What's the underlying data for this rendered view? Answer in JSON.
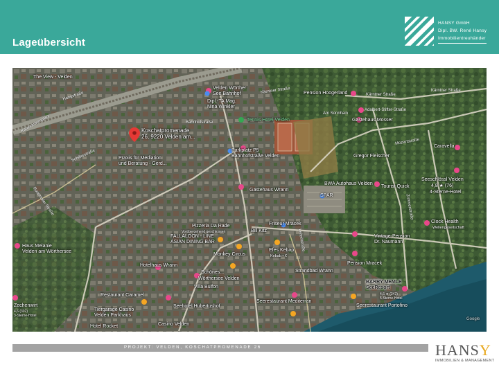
{
  "header": {
    "title": "Lageübersicht",
    "company_line1": "HANSY GmbH",
    "company_line2": "Dipl. BW. René Hansy",
    "company_line3": "Immobilientreuhänder"
  },
  "map": {
    "labels": {
      "main_marker": "Koschatpromenade\n26, 9220 Velden am...",
      "velden_bahnhof": "Velden Wörther\nSee Bahnhof",
      "dipl_ta_mag": "Dipl.-TA Mag.\nNina Winkler",
      "tennis": "Tennis Hotel Velden",
      "pension_hoogerland": "Pension Hoogerland",
      "gaestehaus_mosser": "Gästehaus Mosser",
      "caravella": "Caravella",
      "gregor_fleischer": "Gregor Fleischer",
      "parkplatz": "Parkplatz P5\nBahnhofstraße Velden",
      "mediation": "Praxis für Mediation\nund Beratung - Gerd...",
      "gaestehaus_wrann": "Gästehaus Wrann",
      "bwa_autohaus": "BWA Autohaus Velden",
      "spar": "SPAR",
      "tourist_quick": "Tourist Quick",
      "seeschloessl": "Seeschlössl Velden",
      "seeschloessl_rating": "4,8 ★ (76)",
      "seeschloessl_type": "4-Sterne-Hotel",
      "pizzeria": "Pizzeria Da Rade",
      "pizzeria_sub": "Vorübergehend geschlossen",
      "friseur": "Friseur Mracek",
      "fallalo": "FALLALOON - LINE\nASIAN DINING BAR",
      "bill_kitz": "Bill Kitz",
      "monkey_circus": "Monkey Circus",
      "efes_kebap": "Efes Kebap",
      "efes_sub": "Kebab • €",
      "haus_melanie": "Haus Melanie\nVelden am Wörthersee",
      "hotelhouse": "Hotelhaus Wrann",
      "schoenes": "Schönes...",
      "woerthersee_velden": "Wörthersee Velden",
      "strandbad": "Strandbad Wrann",
      "pension_mracek": "Pension Mracek",
      "vintage": "Vintage-Pension\nDr. Naumann",
      "clock_health": "Clock Health",
      "clock_sub": "Wellengesellschaft",
      "villa_bulfon": "Villa Bulfon",
      "restaurant_caramel": "Restaurant Caramel",
      "zechenwirt": "Zechenwirt",
      "zechenwirt_sub": "4,6 (302)\n3-Sterne-Hotel",
      "seehotel": "Seehotel Hubertushof",
      "seerestaurant": "Seerestaurant Mediterran",
      "barry_memle": "BARRY MEMLE\nSeeResort",
      "barry_sub": "4,6 ★ (343)\n5-Sterne-Hotel",
      "portofino": "Seerestaurant Portofino",
      "tiergarage": "Tiergarage Casino\nVelden Parkhaus",
      "hotel_rocket": "Hotel Rocket",
      "casino": "Casino Velden",
      "the_view": "The View - Velden",
      "copyright": "Google"
    },
    "streets": {
      "hangstrasse": "Hangstraße",
      "kaerntner1": "Kärntner Straße",
      "kaerntner2": "Kärntner Straße",
      "kaerntner3": "Kärntner Straße",
      "adalbert": "Adalbert-Stifter-Straße",
      "am_sonnhain": "Am Sonnhain",
      "mozartstrasse": "Mozartstraße",
      "bahnhofstrasse": "Bahnhofstraße",
      "schillerstrasse": "Schillerstraße",
      "rosentalstrasse": "Rosentaler Straße",
      "zimmerstrasse": "Zimmerstraße",
      "leitenstrasse": "Leitenstraße",
      "karawankenplatz": "Karawankenplatz"
    },
    "colors": {
      "marker_red": "#e53935",
      "marker_pink": "#e8488a",
      "marker_orange": "#f5a623",
      "marker_green": "#34a853",
      "lake": "#1e5a6b"
    }
  },
  "footer": {
    "project": "PROJEKT: VELDEN, KOSCHATPROMENADE 26",
    "logo_main": "HANS",
    "logo_accent": "Y",
    "logo_sub": "IMMOBILIEN & MANAGEMENT"
  }
}
